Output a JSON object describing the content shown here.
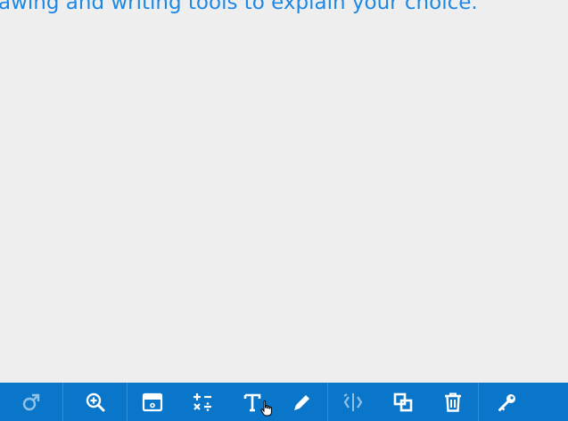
{
  "instructions": {
    "text": "awing and writing tools to explain your choice."
  },
  "toolbar": {
    "items": [
      {
        "name": "rotate-tool",
        "icon": "rotate-icon",
        "enabled": false
      },
      {
        "name": "zoom-tool",
        "icon": "zoom-in-icon",
        "enabled": true
      },
      {
        "name": "background-tool",
        "icon": "image-icon",
        "enabled": true
      },
      {
        "name": "math-tool",
        "icon": "plus-minus-times-divide-icon",
        "enabled": true
      },
      {
        "name": "text-tool",
        "icon": "text-icon",
        "enabled": true
      },
      {
        "name": "pen-tool",
        "icon": "pencil-icon",
        "enabled": true
      },
      {
        "name": "flip-tool",
        "icon": "flip-icon",
        "enabled": false
      },
      {
        "name": "duplicate-tool",
        "icon": "duplicate-icon",
        "enabled": true
      },
      {
        "name": "delete-tool",
        "icon": "trash-icon",
        "enabled": true
      },
      {
        "name": "key-tool",
        "icon": "key-icon",
        "enabled": true
      }
    ],
    "colors": {
      "background": "#0a76c9",
      "icon": "#ffffff",
      "divider": "#2b8fdc"
    }
  },
  "colors": {
    "page_background": "#eeeeee",
    "instruction_text": "#1e88e5"
  }
}
